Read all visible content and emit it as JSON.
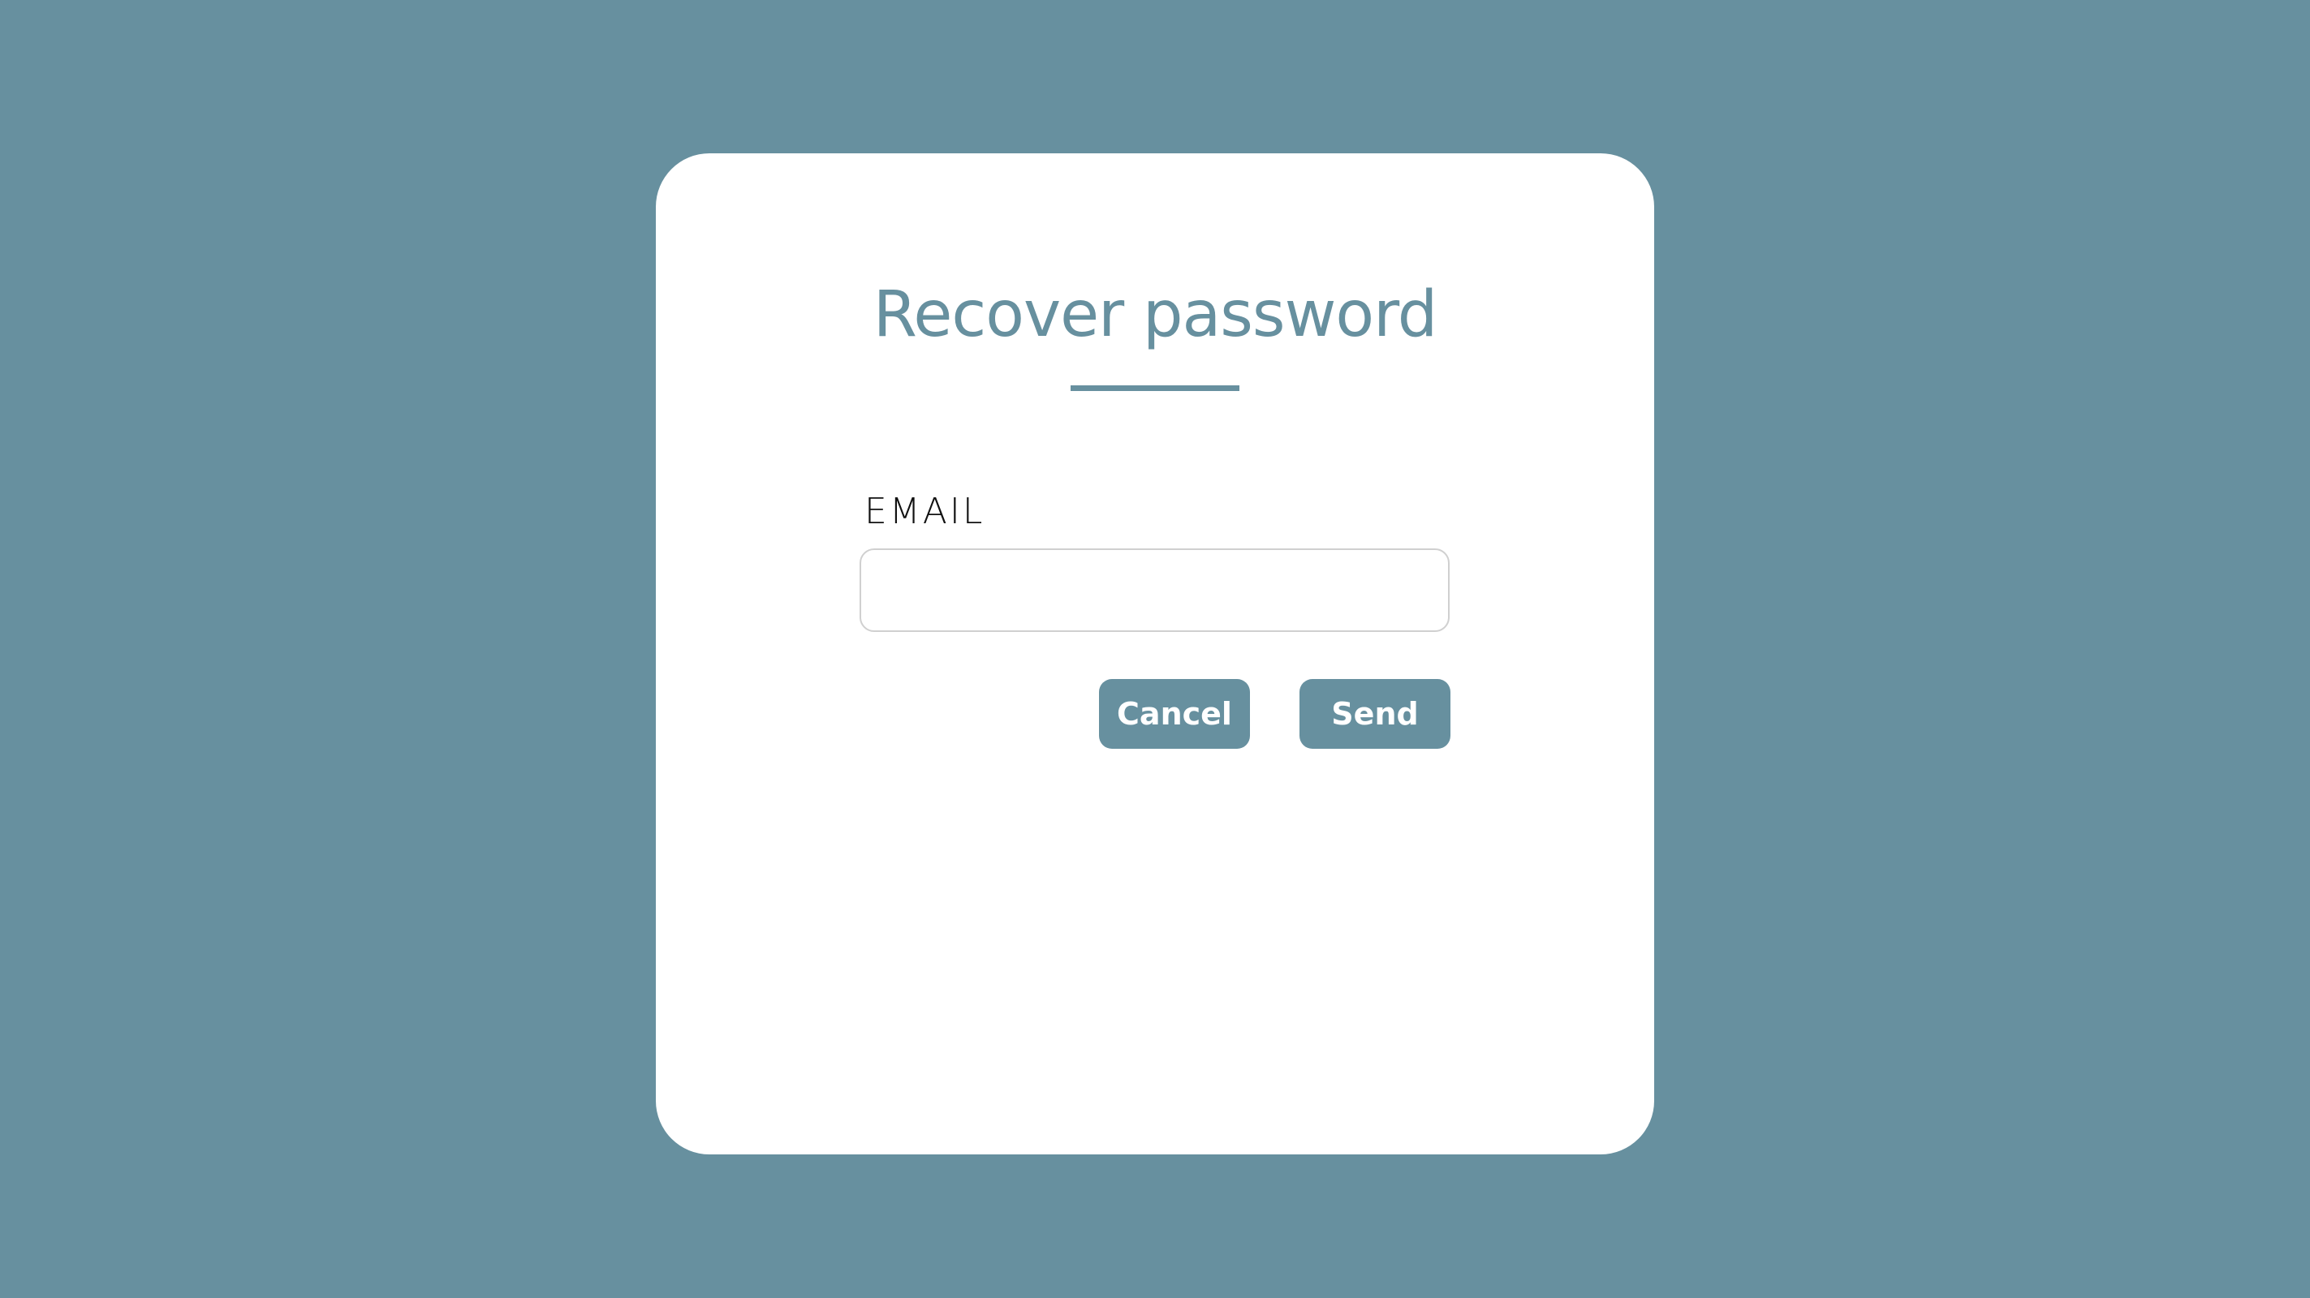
{
  "dialog": {
    "title": "Recover password",
    "email": {
      "label": "EMAIL",
      "value": "",
      "placeholder": ""
    },
    "buttons": {
      "cancel_label": "Cancel",
      "send_label": "Send"
    }
  },
  "colors": {
    "background": "#67909f",
    "accent": "#67909f",
    "card": "#ffffff",
    "input_border": "#d0d0d0"
  }
}
